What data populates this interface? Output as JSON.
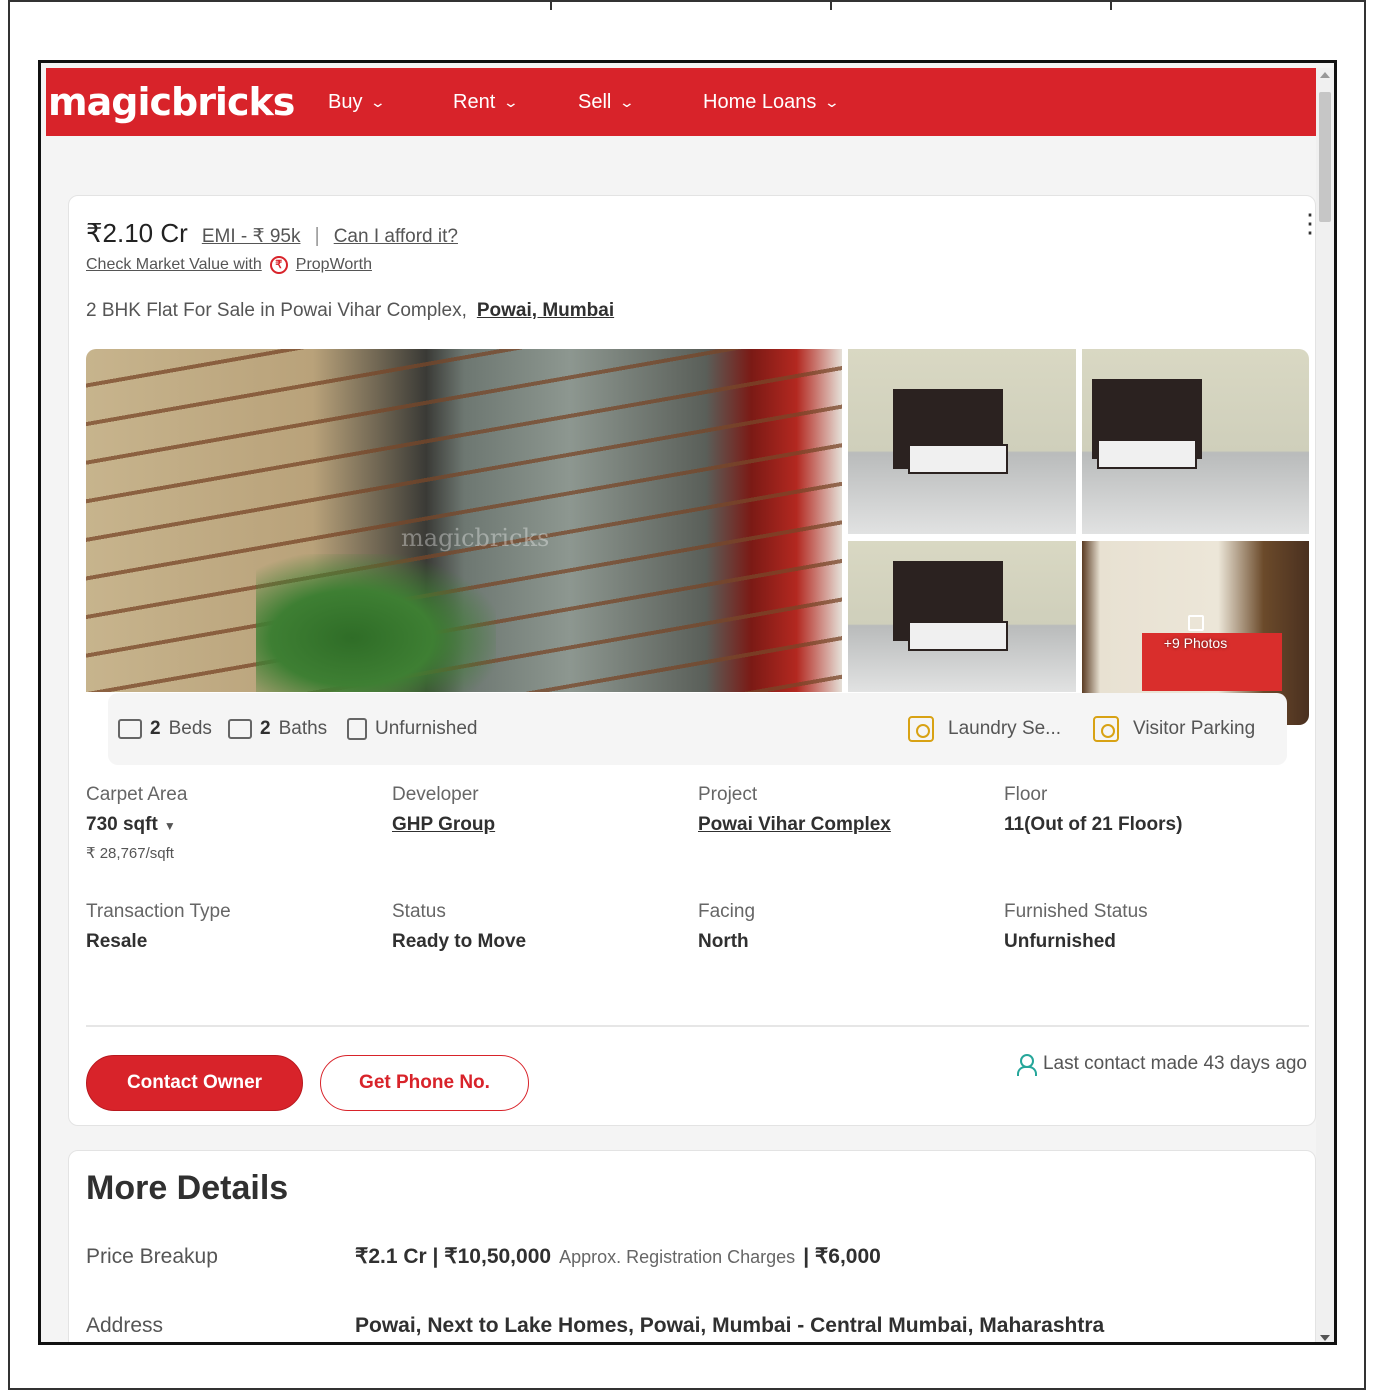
{
  "navbar": {
    "logo": "magicbricks",
    "items": [
      {
        "label": "Buy"
      },
      {
        "label": "Rent"
      },
      {
        "label": "Sell"
      },
      {
        "label": "Home Loans"
      }
    ]
  },
  "listing": {
    "price": "₹2.10 Cr",
    "emi": "EMI - ₹ 95k",
    "separator": "|",
    "afford": "Can I afford it?",
    "market_value_text": "Check Market Value with",
    "propworth": "PropWorth",
    "title": "2 BHK Flat For Sale in Powai Vihar Complex,",
    "location": "Powai, Mumbai",
    "gallery": {
      "more_photos": "+9 Photos",
      "watermark": "magicbricks"
    },
    "features": {
      "beds_count": "2",
      "beds_label": "Beds",
      "baths_count": "2",
      "baths_label": "Baths",
      "furnishing": "Unfurnished",
      "amenity1": "Laundry Se...",
      "amenity2": "Visitor Parking"
    },
    "summary": {
      "carpet_area_label": "Carpet Area",
      "carpet_area_value": "730 sqft",
      "price_per_sqft": "₹ 28,767/sqft",
      "developer_label": "Developer",
      "developer_value": "GHP Group",
      "project_label": "Project",
      "project_value": "Powai Vihar Complex",
      "floor_label": "Floor",
      "floor_value": "11(Out of 21 Floors)",
      "transaction_label": "Transaction Type",
      "transaction_value": "Resale",
      "status_label": "Status",
      "status_value": "Ready to Move",
      "facing_label": "Facing",
      "facing_value": "North",
      "furnished_label": "Furnished Status",
      "furnished_value": "Unfurnished"
    },
    "actions": {
      "contact_owner": "Contact Owner",
      "get_phone": "Get Phone No.",
      "last_contact": "Last contact made 43 days ago"
    }
  },
  "more_details": {
    "title": "More Details",
    "price_breakup_label": "Price Breakup",
    "price_breakup_value": "₹2.1 Cr | ₹10,50,000",
    "registration_label": "Approx. Registration Charges",
    "registration_value": "| ₹6,000",
    "address_label": "Address",
    "address_value": "Powai, Next to Lake Homes, Powai, Mumbai - Central Mumbai, Maharashtra"
  },
  "colors": {
    "brand_red": "#d8232a",
    "teal": "#26a69a",
    "amber": "#d8a214"
  }
}
